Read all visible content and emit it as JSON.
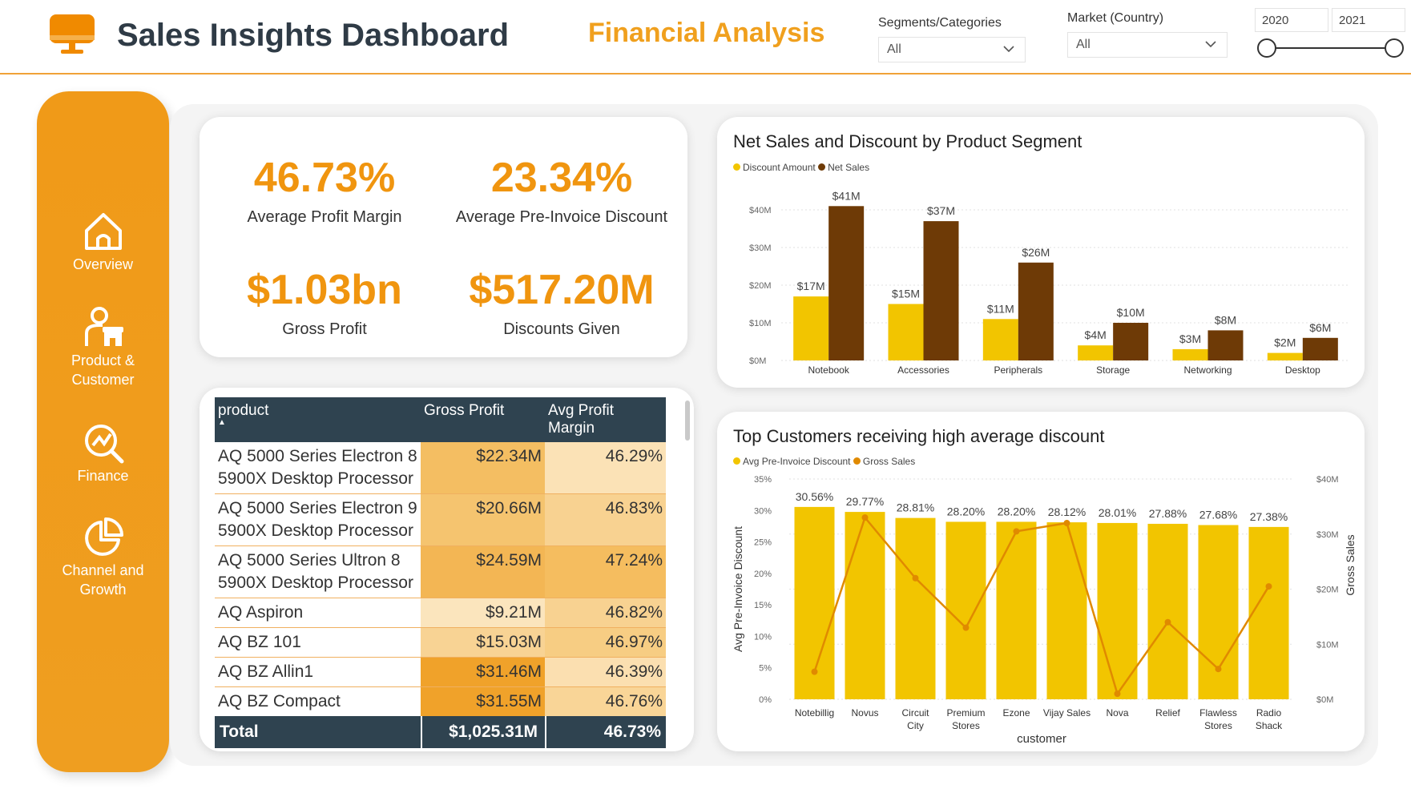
{
  "header": {
    "title": "Sales Insights Dashboard",
    "subtitle": "Financial Analysis",
    "filters": {
      "segments_label": "Segments/Categories",
      "segments_value": "All",
      "market_label": "Market (Country)",
      "market_value": "All",
      "year_start": "2020",
      "year_end": "2021"
    }
  },
  "sidebar": {
    "items": [
      {
        "label": "Overview",
        "icon": "home-icon"
      },
      {
        "label": "Product &\nCustomer",
        "icon": "user-store-icon"
      },
      {
        "label": "Finance",
        "icon": "finance-icon"
      },
      {
        "label": "Channel and\nGrowth",
        "icon": "pie-chart-icon"
      }
    ]
  },
  "kpis": {
    "profit_margin": {
      "value": "46.73%",
      "label": "Average Profit Margin"
    },
    "pre_invoice": {
      "value": "23.34%",
      "label": "Average Pre-Invoice Discount"
    },
    "gross_profit": {
      "value": "$1.03bn",
      "label": "Gross Profit"
    },
    "discounts": {
      "value": "$517.20M",
      "label": "Discounts Given"
    }
  },
  "table": {
    "headers": [
      "product",
      "Gross Profit",
      "Avg Profit Margin"
    ],
    "rows": [
      {
        "product": "AQ 5000 Series Electron 8 5900X Desktop Processor",
        "gp": "$22.34M",
        "apm": "46.29%",
        "gp_color": "#f4be62",
        "apm_color": "#fbe2b6"
      },
      {
        "product": "AQ 5000 Series Electron 9 5900X Desktop Processor",
        "gp": "$20.66M",
        "apm": "46.83%",
        "gp_color": "#f5c46f",
        "apm_color": "#f8d291"
      },
      {
        "product": "AQ 5000 Series Ultron 8 5900X Desktop Processor",
        "gp": "$24.59M",
        "apm": "47.24%",
        "gp_color": "#f3b654",
        "apm_color": "#f5bd5f"
      },
      {
        "product": "AQ Aspiron",
        "gp": "$9.21M",
        "apm": "46.82%",
        "gp_color": "#fbe5bd",
        "apm_color": "#f8d291"
      },
      {
        "product": "AQ BZ 101",
        "gp": "$15.03M",
        "apm": "46.97%",
        "gp_color": "#f8d394",
        "apm_color": "#f7cd83"
      },
      {
        "product": "AQ BZ Allin1",
        "gp": "$31.46M",
        "apm": "46.39%",
        "gp_color": "#f0a22a",
        "apm_color": "#fbdfb0"
      },
      {
        "product": "AQ BZ Compact",
        "gp": "$31.55M",
        "apm": "46.76%",
        "gp_color": "#f0a22a",
        "apm_color": "#f9d597"
      }
    ],
    "total": {
      "label": "Total",
      "gp": "$1,025.31M",
      "apm": "46.73%"
    }
  },
  "colors": {
    "accent": "#f0950f",
    "discount": "#f2c500",
    "net_sales": "#6e3a06",
    "gross_sales_line": "#e08a00",
    "header_dark": "#2f4350"
  },
  "chart_data": [
    {
      "type": "bar",
      "title": "Net Sales and Discount by Product Segment",
      "categories": [
        "Notebook",
        "Accessories",
        "Peripherals",
        "Storage",
        "Networking",
        "Desktop"
      ],
      "series": [
        {
          "name": "Discount Amount",
          "values": [
            17,
            15,
            11,
            4,
            3,
            2
          ],
          "labels": [
            "$17M",
            "$15M",
            "$11M",
            "$4M",
            "$3M",
            "$2M"
          ]
        },
        {
          "name": "Net Sales",
          "values": [
            41,
            37,
            26,
            10,
            8,
            6
          ],
          "labels": [
            "$41M",
            "$37M",
            "$26M",
            "$10M",
            "$8M",
            "$6M"
          ]
        }
      ],
      "ylim": [
        0,
        40
      ],
      "yticks": [
        "$0M",
        "$10M",
        "$20M",
        "$30M",
        "$40M"
      ],
      "legend": "top-left"
    },
    {
      "type": "bar",
      "title": "Top Customers receiving high average discount",
      "categories": [
        "Notebillig",
        "Novus",
        "Circuit\nCity",
        "Premium\nStores",
        "Ezone",
        "Vijay Sales",
        "Nova",
        "Relief",
        "Flawless\nStores",
        "Radio\nShack"
      ],
      "series": [
        {
          "name": "Avg Pre-Invoice Discount",
          "values": [
            30.56,
            29.77,
            28.81,
            28.2,
            28.2,
            28.12,
            28.01,
            27.88,
            27.68,
            27.38
          ],
          "labels": [
            "30.56%",
            "29.77%",
            "28.81%",
            "28.20%",
            "28.20%",
            "28.12%",
            "28.01%",
            "27.88%",
            "27.68%",
            "27.38%"
          ]
        },
        {
          "name": "Gross Sales",
          "type": "line",
          "values": [
            5,
            33,
            22,
            13,
            30.5,
            32,
            1,
            14,
            5.5,
            20.5
          ]
        }
      ],
      "xlabel": "customer",
      "ylabel": "Avg Pre-Invoice Discount",
      "y2label": "Gross Sales",
      "ylim": [
        0,
        35
      ],
      "y2lim": [
        0,
        40
      ],
      "yticks": [
        "0%",
        "5%",
        "10%",
        "15%",
        "20%",
        "25%",
        "30%",
        "35%"
      ],
      "y2ticks": [
        "$0M",
        "$10M",
        "$20M",
        "$30M",
        "$40M"
      ],
      "legend": "top-left"
    }
  ]
}
